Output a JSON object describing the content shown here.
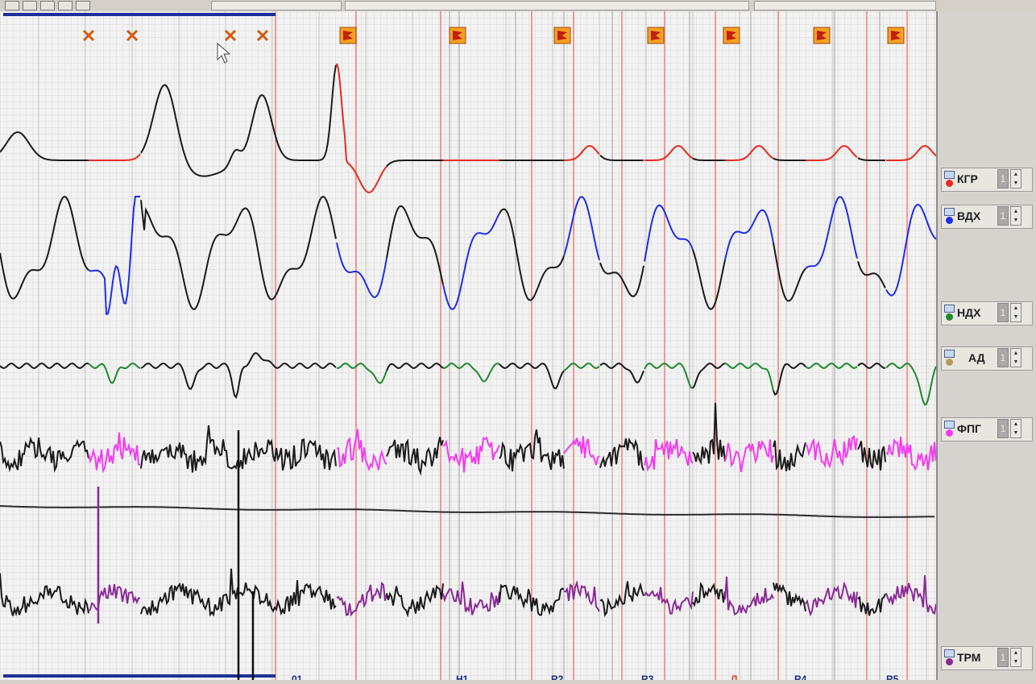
{
  "channels": [
    {
      "label": "КГР",
      "color": "#e52b20",
      "spin": "1"
    },
    {
      "label": "ВДХ",
      "color": "#1f2ee8",
      "spin": "1"
    },
    {
      "label": "НДХ",
      "color": "#1e8a2e",
      "spin": "1"
    },
    {
      "label": "АД",
      "color": "#b89a5a",
      "spin": "1"
    },
    {
      "label": "ФПГ",
      "color": "#f23cf0",
      "spin": "1"
    },
    {
      "label": "ТРМ",
      "color": "#8a2a96",
      "spin": "1"
    }
  ],
  "questions": [
    "01",
    "Н1",
    "R2",
    "R3",
    "Л",
    "R4",
    "R5"
  ],
  "colors": {
    "accent_red": "#e83b2e",
    "grid_minor": "#d9d9d9",
    "grid_major": "#c2c2c2"
  },
  "icons": [
    "cross-mark-icon",
    "flag-icon",
    "cursor-icon",
    "channel-settings-icon"
  ]
}
